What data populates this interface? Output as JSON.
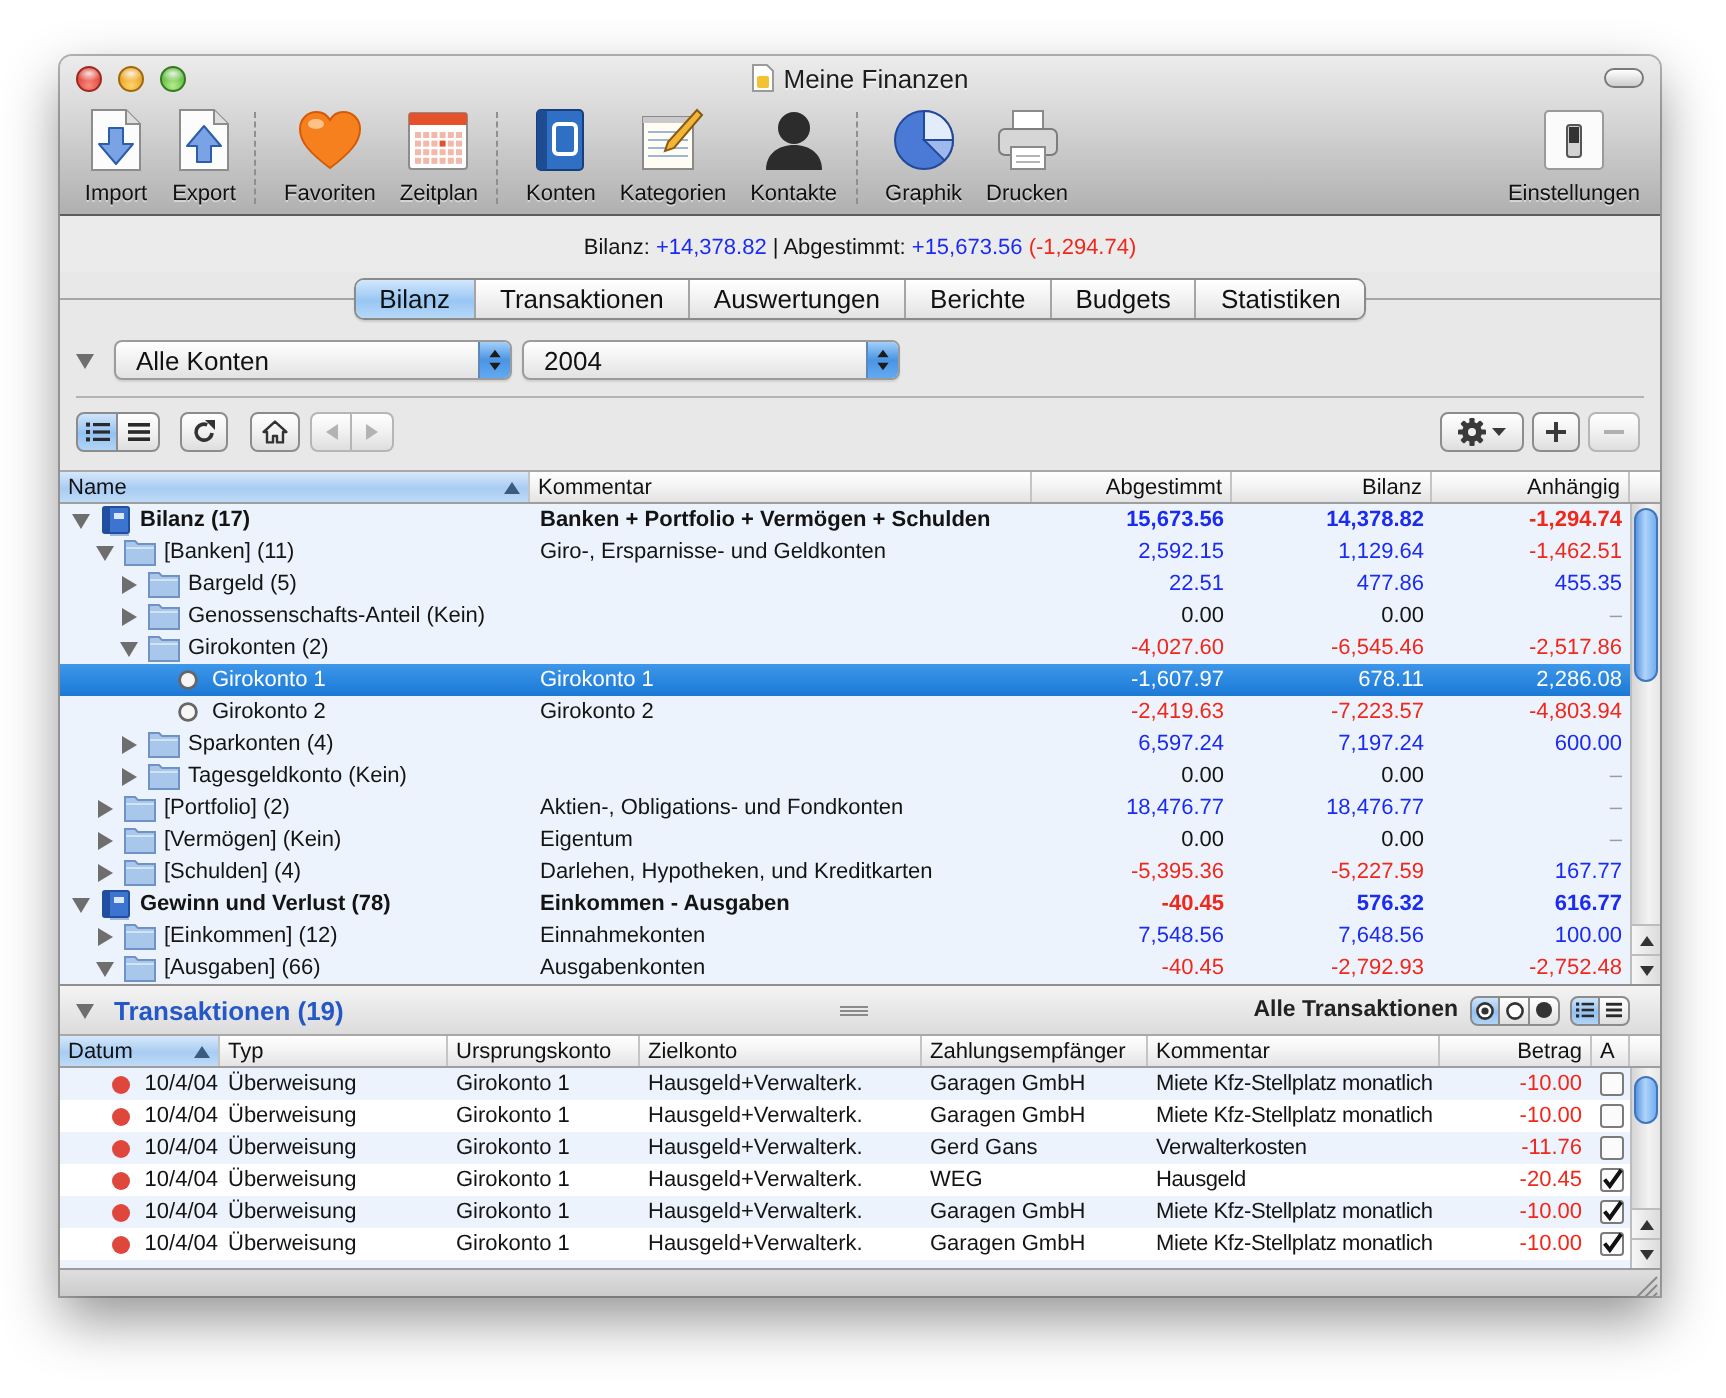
{
  "window": {
    "title": "Meine Finanzen"
  },
  "toolbar": {
    "groups": [
      [
        {
          "label": "Import"
        },
        {
          "label": "Export"
        }
      ],
      [
        {
          "label": "Favoriten"
        },
        {
          "label": "Zeitplan"
        }
      ],
      [
        {
          "label": "Konten"
        },
        {
          "label": "Kategorien"
        },
        {
          "label": "Kontakte"
        }
      ],
      [
        {
          "label": "Graphik"
        },
        {
          "label": "Drucken"
        }
      ]
    ],
    "trailing": {
      "label": "Einstellungen"
    }
  },
  "summary": [
    {
      "text": "Bilanz:"
    },
    {
      "text": "+14,378.82",
      "color": "#1a2bf2"
    },
    {
      "text": "| Abgestimmt:"
    },
    {
      "text": "+15,673.56",
      "color": "#1a2bf2"
    },
    {
      "text": "(-1,294.74)",
      "color": "#f0281c"
    }
  ],
  "tabs": [
    {
      "label": "Bilanz",
      "selected": true
    },
    {
      "label": "Transaktionen",
      "selected": false
    },
    {
      "label": "Auswertungen",
      "selected": false
    },
    {
      "label": "Berichte",
      "selected": false
    },
    {
      "label": "Budgets",
      "selected": false
    },
    {
      "label": "Statistiken",
      "selected": false
    }
  ],
  "filter": {
    "expanded": true,
    "account": "Alle Konten",
    "period": "2004"
  },
  "controls": {
    "view_modes": [
      {
        "selected": true
      },
      {
        "selected": false
      }
    ],
    "history": [
      {
        "disabled": true
      },
      {
        "disabled": true
      }
    ],
    "actions": [
      {
        "disabled": false
      },
      {
        "disabled": false
      },
      {
        "disabled": true
      }
    ]
  },
  "accounts": {
    "columns": [
      {
        "label": "Name",
        "sorted": true
      },
      {
        "label": "Kommentar",
        "sorted": false
      },
      {
        "label": "Abgestimmt",
        "sorted": false
      },
      {
        "label": "Bilanz",
        "sorted": false
      },
      {
        "label": "Anhängig",
        "sorted": false
      }
    ],
    "rows": [
      {
        "kind": "group",
        "name": "Bilanz (17)",
        "comment": "Banken + Portfolio + Vermögen + Schulden",
        "values": [
          {
            "text": "15,673.56",
            "color": "#1a2bf2"
          },
          {
            "text": "14,378.82",
            "color": "#1a2bf2"
          },
          {
            "text": "-1,294.74",
            "color": "#f0281c"
          }
        ],
        "expanded": true,
        "selected": false,
        "children": [
          {
            "kind": "folder",
            "name": "[Banken] (11)",
            "comment": "Giro-, Ersparnisse- und Geldkonten",
            "values": [
              {
                "text": "2,592.15",
                "color": "#1a2bf2"
              },
              {
                "text": "1,129.64",
                "color": "#1a2bf2"
              },
              {
                "text": "-1,462.51",
                "color": "#f0281c"
              }
            ],
            "expanded": true,
            "selected": false,
            "children": [
              {
                "kind": "folder",
                "name": "Bargeld (5)",
                "values": [
                  {
                    "text": "22.51",
                    "color": "#1a2bf2"
                  },
                  {
                    "text": "477.86",
                    "color": "#1a2bf2"
                  },
                  {
                    "text": "455.35",
                    "color": "#1a2bf2"
                  }
                ],
                "expanded": false,
                "selected": false
              },
              {
                "kind": "folder",
                "name": "Genossenschafts-Anteil (Kein)",
                "values": [
                  {
                    "text": "0.00",
                    "color": "#141414"
                  },
                  {
                    "text": "0.00",
                    "color": "#141414"
                  },
                  {
                    "text": "–",
                    "color": "#9c9c9c"
                  }
                ],
                "expanded": false,
                "selected": false
              },
              {
                "kind": "folder",
                "name": "Girokonten (2)",
                "values": [
                  {
                    "text": "-4,027.60",
                    "color": "#f0281c"
                  },
                  {
                    "text": "-6,545.46",
                    "color": "#f0281c"
                  },
                  {
                    "text": "-2,517.86",
                    "color": "#f0281c"
                  }
                ],
                "expanded": true,
                "selected": false,
                "children": [
                  {
                    "kind": "account",
                    "name": "Girokonto 1",
                    "comment": "Girokonto 1",
                    "values": [
                      {
                        "text": "-1,607.97"
                      },
                      {
                        "text": "678.11"
                      },
                      {
                        "text": "2,286.08"
                      }
                    ],
                    "selected": true
                  },
                  {
                    "kind": "account",
                    "name": "Girokonto 2",
                    "comment": "Girokonto 2",
                    "values": [
                      {
                        "text": "-2,419.63",
                        "color": "#f0281c"
                      },
                      {
                        "text": "-7,223.57",
                        "color": "#f0281c"
                      },
                      {
                        "text": "-4,803.94",
                        "color": "#f0281c"
                      }
                    ],
                    "selected": false
                  }
                ]
              },
              {
                "kind": "folder",
                "name": "Sparkonten (4)",
                "values": [
                  {
                    "text": "6,597.24",
                    "color": "#1a2bf2"
                  },
                  {
                    "text": "7,197.24",
                    "color": "#1a2bf2"
                  },
                  {
                    "text": "600.00",
                    "color": "#1a2bf2"
                  }
                ],
                "expanded": false,
                "selected": false
              },
              {
                "kind": "folder",
                "name": "Tagesgeldkonto (Kein)",
                "values": [
                  {
                    "text": "0.00",
                    "color": "#141414"
                  },
                  {
                    "text": "0.00",
                    "color": "#141414"
                  },
                  {
                    "text": "–",
                    "color": "#9c9c9c"
                  }
                ],
                "expanded": false,
                "selected": false
              }
            ]
          },
          {
            "kind": "folder",
            "name": "[Portfolio] (2)",
            "comment": "Aktien-, Obligations- und Fondkonten",
            "values": [
              {
                "text": "18,476.77",
                "color": "#1a2bf2"
              },
              {
                "text": "18,476.77",
                "color": "#1a2bf2"
              },
              {
                "text": "–",
                "color": "#9c9c9c"
              }
            ],
            "expanded": false,
            "selected": false
          },
          {
            "kind": "folder",
            "name": "[Vermögen] (Kein)",
            "comment": "Eigentum",
            "values": [
              {
                "text": "0.00",
                "color": "#141414"
              },
              {
                "text": "0.00",
                "color": "#141414"
              },
              {
                "text": "–",
                "color": "#9c9c9c"
              }
            ],
            "expanded": false,
            "selected": false
          },
          {
            "kind": "folder",
            "name": "[Schulden] (4)",
            "comment": "Darlehen, Hypotheken, und Kreditkarten",
            "values": [
              {
                "text": "-5,395.36",
                "color": "#f0281c"
              },
              {
                "text": "-5,227.59",
                "color": "#f0281c"
              },
              {
                "text": "167.77",
                "color": "#1a2bf2"
              }
            ],
            "expanded": false,
            "selected": false
          }
        ]
      },
      {
        "kind": "group",
        "name": "Gewinn und Verlust (78)",
        "comment": "Einkommen - Ausgaben",
        "values": [
          {
            "text": "-40.45",
            "color": "#f0281c"
          },
          {
            "text": "576.32",
            "color": "#1a2bf2"
          },
          {
            "text": "616.77",
            "color": "#1a2bf2"
          }
        ],
        "expanded": true,
        "selected": false,
        "children": [
          {
            "kind": "folder",
            "name": "[Einkommen] (12)",
            "comment": "Einnahmekonten",
            "values": [
              {
                "text": "7,548.56",
                "color": "#1a2bf2"
              },
              {
                "text": "7,648.56",
                "color": "#1a2bf2"
              },
              {
                "text": "100.00",
                "color": "#1a2bf2"
              }
            ],
            "expanded": false,
            "selected": false
          },
          {
            "kind": "folder",
            "name": "[Ausgaben] (66)",
            "comment": "Ausgabenkonten",
            "values": [
              {
                "text": "-40.45",
                "color": "#f0281c"
              },
              {
                "text": "-2,792.93",
                "color": "#f0281c"
              },
              {
                "text": "-2,752.48",
                "color": "#f0281c"
              }
            ],
            "expanded": true,
            "selected": false
          }
        ]
      }
    ]
  },
  "transactions": {
    "title": "Transaktionen (19)",
    "expanded": true,
    "filter_label": "Alle Transaktionen",
    "filters": [
      {
        "selected": true
      },
      {
        "selected": false
      },
      {
        "selected": false
      }
    ],
    "view_modes": [
      {
        "selected": true
      },
      {
        "selected": false
      }
    ],
    "columns": [
      {
        "label": "Datum",
        "sorted": true
      },
      {
        "label": "Typ",
        "sorted": false
      },
      {
        "label": "Ursprungskonto",
        "sorted": false
      },
      {
        "label": "Zielkonto",
        "sorted": false
      },
      {
        "label": "Zahlungsempfänger",
        "sorted": false
      },
      {
        "label": "Kommentar",
        "sorted": false
      },
      {
        "label": "Betrag",
        "sorted": false
      },
      {
        "label": "A",
        "sorted": false
      }
    ],
    "rows": [
      {
        "color": "#e0473c",
        "date": "10/4/04",
        "type": "Überweisung",
        "source": "Girokonto 1",
        "target": "Hausgeld+Verwalterk.",
        "payee": "Garagen GmbH",
        "comment": "Miete Kfz-Stellplatz monatlich",
        "amount": {
          "text": "-10.00",
          "color": "#f0281c"
        },
        "checked": false,
        "selected": false
      },
      {
        "color": "#e0473c",
        "date": "10/4/04",
        "type": "Überweisung",
        "source": "Girokonto 1",
        "target": "Hausgeld+Verwalterk.",
        "payee": "Garagen GmbH",
        "comment": "Miete Kfz-Stellplatz monatlich",
        "amount": {
          "text": "-10.00",
          "color": "#f0281c"
        },
        "checked": false,
        "selected": false
      },
      {
        "color": "#e0473c",
        "date": "10/4/04",
        "type": "Überweisung",
        "source": "Girokonto 1",
        "target": "Hausgeld+Verwalterk.",
        "payee": "Gerd Gans",
        "comment": "Verwalterkosten",
        "amount": {
          "text": "-11.76",
          "color": "#f0281c"
        },
        "checked": false,
        "selected": false
      },
      {
        "color": "#e0473c",
        "date": "10/4/04",
        "type": "Überweisung",
        "source": "Girokonto 1",
        "target": "Hausgeld+Verwalterk.",
        "payee": "WEG",
        "comment": "Hausgeld",
        "amount": {
          "text": "-20.45",
          "color": "#f0281c"
        },
        "checked": true,
        "selected": false
      },
      {
        "color": "#e0473c",
        "date": "10/4/04",
        "type": "Überweisung",
        "source": "Girokonto 1",
        "target": "Hausgeld+Verwalterk.",
        "payee": "Garagen GmbH",
        "comment": "Miete Kfz-Stellplatz monatlich",
        "amount": {
          "text": "-10.00",
          "color": "#f0281c"
        },
        "checked": true,
        "selected": false
      },
      {
        "color": "#e0473c",
        "date": "10/4/04",
        "type": "Überweisung",
        "source": "Girokonto 1",
        "target": "Hausgeld+Verwalterk.",
        "payee": "Garagen GmbH",
        "comment": "Miete Kfz-Stellplatz monatlich",
        "amount": {
          "text": "-10.00",
          "color": "#f0281c"
        },
        "checked": true,
        "selected": false
      }
    ]
  }
}
